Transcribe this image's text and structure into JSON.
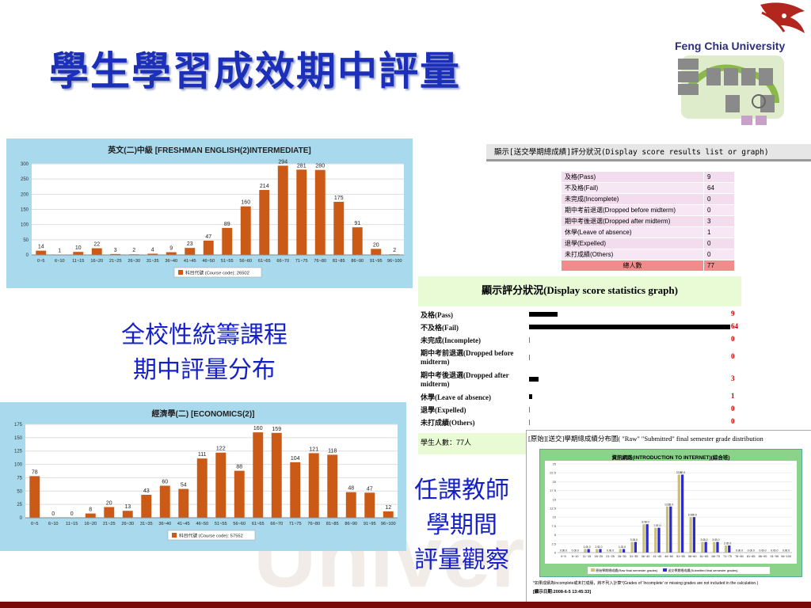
{
  "title": "學生學習成效期中評量",
  "university": "Feng Chia University",
  "side_text_1": [
    "全校性統籌課程",
    "期中評量分布"
  ],
  "side_text_2": [
    "任課教師",
    "學期間",
    "評量觀察"
  ],
  "watermark": "University",
  "chart1": {
    "title": "英文(二)中級 [FRESHMAN ENGLISH(2)INTERMEDIATE]",
    "legend": "科目代號 (Course code): 26502",
    "color": "#cc5a17",
    "chart_data": {
      "type": "bar",
      "categories": [
        "0~5",
        "6~10",
        "11~15",
        "16~20",
        "21~25",
        "26~30",
        "31~35",
        "36~40",
        "41~45",
        "46~50",
        "51~55",
        "56~60",
        "61~65",
        "66~70",
        "71~75",
        "76~80",
        "81~85",
        "86~90",
        "91~95",
        "96~100"
      ],
      "values": [
        14,
        1,
        10,
        22,
        3,
        2,
        4,
        9,
        23,
        47,
        89,
        160,
        214,
        294,
        281,
        280,
        175,
        91,
        20,
        2
      ],
      "ylim": [
        0,
        300
      ],
      "yticks": [
        0,
        50,
        100,
        150,
        200,
        250,
        300
      ],
      "grid": true
    }
  },
  "chart2": {
    "title": "經濟學(二) [ECONOMICS(2)]",
    "legend": "科目代號 (Course code): 57552",
    "color": "#cc5a17",
    "chart_data": {
      "type": "bar",
      "categories": [
        "0~5",
        "6~10",
        "11~15",
        "16~20",
        "21~25",
        "26~30",
        "31~35",
        "36~40",
        "41~45",
        "46~50",
        "51~55",
        "56~60",
        "61~65",
        "66~70",
        "71~75",
        "76~80",
        "81~85",
        "86~90",
        "91~95",
        "96~100"
      ],
      "values": [
        78,
        0,
        0,
        8,
        20,
        13,
        43,
        60,
        54,
        111,
        122,
        88,
        160,
        159,
        104,
        121,
        118,
        48,
        47,
        12
      ],
      "ylim": [
        0,
        175
      ],
      "yticks": [
        0,
        25,
        50,
        75,
        100,
        125,
        150,
        175
      ],
      "grid": true
    }
  },
  "score_list": {
    "header": "顯示[送交學期總成績]評分狀況(Display score results list or graph)",
    "rows": [
      {
        "label": "及格(Pass)",
        "value": "9"
      },
      {
        "label": "不及格(Fail)",
        "value": "64"
      },
      {
        "label": "未完成(Incomplete)",
        "value": "0"
      },
      {
        "label": "期中考前退選(Dropped before midterm)",
        "value": "0"
      },
      {
        "label": "期中考後退選(Dropped after midterm)",
        "value": "3"
      },
      {
        "label": "休學(Leave of absence)",
        "value": "1"
      },
      {
        "label": "退學(Expelled)",
        "value": "0"
      },
      {
        "label": "未打成績(Others)",
        "value": "0"
      }
    ],
    "total_label": "總人數",
    "total_value": "77"
  },
  "stat_graph": {
    "title": "顯示評分狀況(Display score statistics graph)",
    "footer": "學生人數：77人",
    "max": 64,
    "rows": [
      {
        "label": "及格(Pass)",
        "value": 9,
        "text": "9"
      },
      {
        "label": "不及格(Fail)",
        "value": 64,
        "text": "64"
      },
      {
        "label": "未完成(Incomplete)",
        "value": 0,
        "text": "0"
      },
      {
        "label": "期中考前退選(Dropped before midterm)",
        "value": 0,
        "text": "0"
      },
      {
        "label": "期中考後退選(Dropped after midterm)",
        "value": 3,
        "text": "3"
      },
      {
        "label": "休學(Leave of absence)",
        "value": 1,
        "text": "1"
      },
      {
        "label": "退學(Expelled)",
        "value": 0,
        "text": "0"
      },
      {
        "label": "未打成績(Others)",
        "value": 0,
        "text": "0"
      }
    ]
  },
  "grade_dist": {
    "header": "[原始][送交]學期總成績分布圖( \"Raw\"  \"Submitted\"  final semester grade distribution",
    "title": "資訊網路(INTRODUCTION TO INTERNET)(綜合班)",
    "legend_raw": "原始學期總成績(Raw final semester grades)",
    "legend_sub": "送交學期總成績(Submitted final semester grades)",
    "note": "*如果成績為Incomplete或未打成績，將不列入計算*(Grades of 'Incomplete' or missing grades are not included in the calculation.)",
    "date": "[顯示日期:2008-6-5 13:45:33]",
    "chart_data": {
      "type": "bar",
      "categories": [
        "0~5",
        "6~10",
        "11~15",
        "16~20",
        "21~25",
        "26~30",
        "31~35",
        "36~40",
        "41~45",
        "46~50",
        "51~55",
        "56~60",
        "61~65",
        "66~70",
        "71~75",
        "76~80",
        "81~85",
        "86~90",
        "91~95",
        "96~100"
      ],
      "ylim": [
        0,
        25
      ],
      "yticks": [
        0,
        2.5,
        5,
        7.5,
        10,
        12.5,
        15,
        17.5,
        20,
        22.5,
        25
      ],
      "series": [
        {
          "name": "原始學期總成績(Raw final semester grades)",
          "color": "#c8c07a",
          "values": [
            0,
            0,
            1,
            1,
            0,
            1,
            3,
            8,
            7,
            13,
            22,
            10,
            3,
            3,
            2,
            0,
            0,
            0,
            0,
            0
          ]
        },
        {
          "name": "送交學期總成績(Submitted final semester grades)",
          "color": "#2b2bd0",
          "values": [
            0,
            0,
            1,
            1,
            0,
            1,
            3,
            8,
            7,
            13,
            22,
            10,
            3,
            3,
            2,
            0,
            0,
            0,
            0,
            0
          ]
        }
      ]
    }
  }
}
